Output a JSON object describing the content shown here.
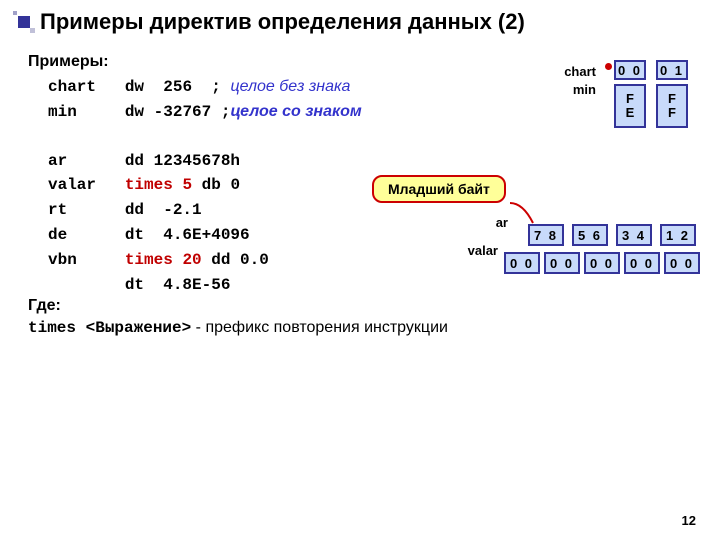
{
  "title": "Примеры директив определения данных (2)",
  "examples_label": "Примеры:",
  "code": {
    "l1_name": "chart",
    "l1_dir": "dw  256",
    "l1_semi": "  ; ",
    "l1_comment": "целое без знака",
    "l2_name": "min",
    "l2_dir": "dw -32767 ",
    "l2_semi": ";",
    "l2_comment": "целое со знаком",
    "l3_name": "ar",
    "l3_dir": "dd 12345678h",
    "l4_name": "valar",
    "l4_red": "times 5",
    "l4_dir": " db 0",
    "l5_name": "rt",
    "l5_dir": "dd  -2.1",
    "l6_name": "de",
    "l6_dir": "dt  4.6E+4096",
    "l7_name": "vbn",
    "l7_red": "times 20",
    "l7_dir": " dd 0.0",
    "l8_dir": "dt  4.8E-56"
  },
  "where_label": "Где:",
  "where_prefix": "times <Выражение>",
  "where_suffix": " -  префикс повторения инструкции",
  "diagram": {
    "chart_label": "chart",
    "min_label": "min",
    "ar_label": "ar",
    "valar_label": "valar",
    "chart_top1": "0 0",
    "chart_top2": "0 1",
    "min_b1a": "F",
    "min_b1b": "E",
    "min_b2a": "F",
    "min_b2b": "F",
    "callout": "Младший байт",
    "ar_b1": "7 8",
    "ar_b2": "5 6",
    "ar_b3": "3 4",
    "ar_b4": "1 2",
    "valar_b": "0 0"
  },
  "page_number": "12"
}
